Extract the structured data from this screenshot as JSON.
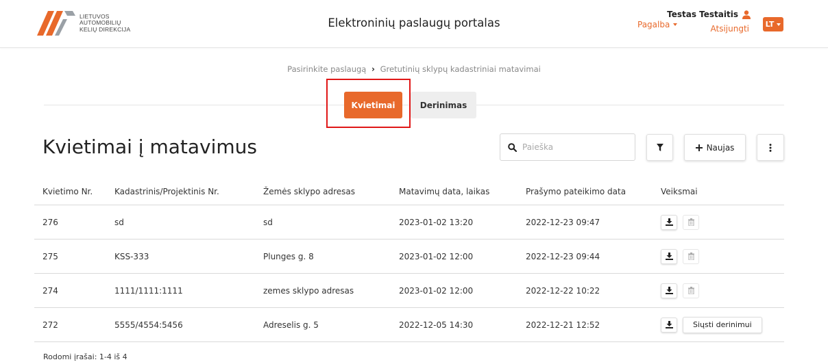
{
  "header": {
    "logo_lines": [
      "LIETUVOS",
      "AUTOMOBILIŲ",
      "KELIŲ DIREKCIJA"
    ],
    "portal_title": "Elektroninių paslaugų portalas",
    "help_label": "Pagalba",
    "user_name": "Testas Testaitis",
    "logout_label": "Atsijungti",
    "language": "LT"
  },
  "breadcrumb": {
    "parent": "Pasirinkite paslaugą",
    "current": "Gretutinių sklypų kadastriniai matavimai"
  },
  "tabs": [
    {
      "label": "Kvietimai",
      "active": true
    },
    {
      "label": "Derinimas",
      "active": false
    }
  ],
  "page": {
    "title": "Kvietimai į matavimus",
    "search_placeholder": "Paieška",
    "new_label": "Naujas"
  },
  "table": {
    "columns": [
      "Kvietimo Nr.",
      "Kadastrinis/Projektinis Nr.",
      "Žemės sklypo adresas",
      "Matavimų data, laikas",
      "Prašymo pateikimo data",
      "Veiksmai"
    ],
    "rows": [
      {
        "nr": "276",
        "cadastral": "sd",
        "address": "sd",
        "measure_date": "2023-01-02 13:20",
        "request_date": "2022-12-23 09:47"
      },
      {
        "nr": "275",
        "cadastral": "KSS-333",
        "address": "Plunges g. 8",
        "measure_date": "2023-01-02 12:00",
        "request_date": "2022-12-23 09:44"
      },
      {
        "nr": "274",
        "cadastral": "1111/1111:1111",
        "address": "zemes sklypo adresas",
        "measure_date": "2023-01-02 12:00",
        "request_date": "2022-12-22 10:22"
      },
      {
        "nr": "272",
        "cadastral": "5555/4554:5456",
        "address": "Adreselis g. 5",
        "measure_date": "2022-12-05 14:30",
        "request_date": "2022-12-21 12:52",
        "send_label": "Siųsti derinimui"
      }
    ]
  },
  "footer": {
    "records_text": "Rodomi įrašai: 1-4 iš 4"
  },
  "colors": {
    "accent": "#e8692b",
    "highlight": "#e01616"
  }
}
